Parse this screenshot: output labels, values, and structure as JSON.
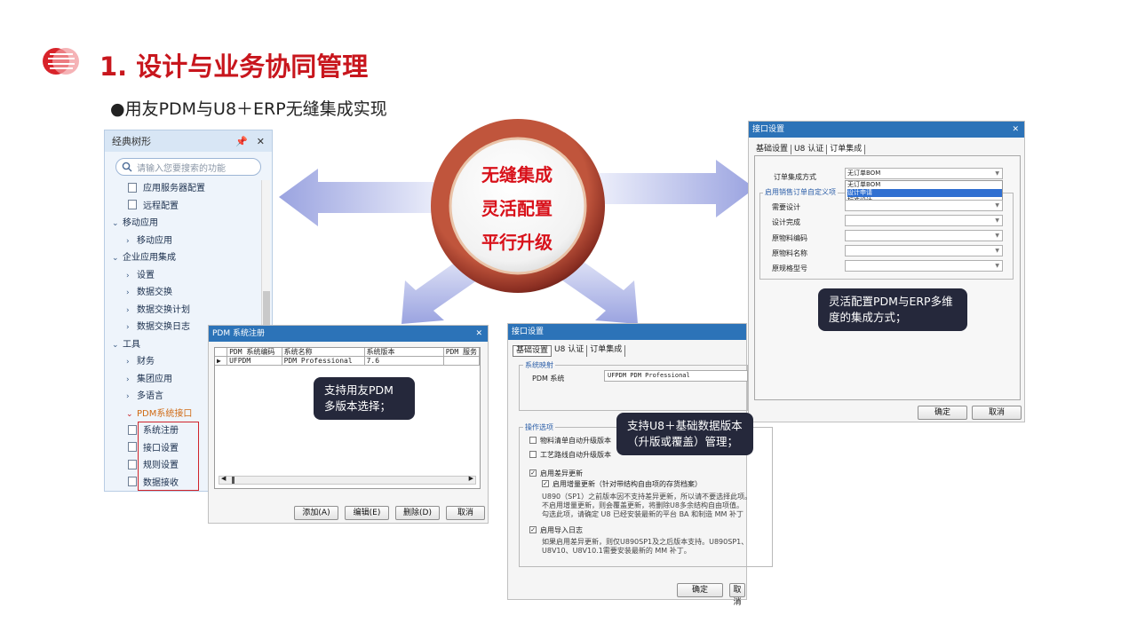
{
  "header": {
    "title": "1. 设计与业务协同管理",
    "subtitle": "●用友PDM与U8＋ERP无缝集成实现"
  },
  "center": {
    "lines": [
      "无缝集成",
      "灵活配置",
      "平行升级"
    ]
  },
  "tree": {
    "title": "经典树形",
    "search_placeholder": "请输入您要搜索的功能",
    "items": [
      {
        "label": "应用服务器配置",
        "level": 2,
        "kind": "doc"
      },
      {
        "label": "远程配置",
        "level": 2,
        "kind": "doc"
      },
      {
        "label": "移动应用",
        "level": 0,
        "kind": "open"
      },
      {
        "label": "移动应用",
        "level": 1,
        "kind": "closed"
      },
      {
        "label": "企业应用集成",
        "level": 0,
        "kind": "open"
      },
      {
        "label": "设置",
        "level": 1,
        "kind": "closed"
      },
      {
        "label": "数据交换",
        "level": 1,
        "kind": "closed"
      },
      {
        "label": "数据交换计划",
        "level": 1,
        "kind": "closed"
      },
      {
        "label": "数据交换日志",
        "level": 1,
        "kind": "closed"
      },
      {
        "label": "工具",
        "level": 0,
        "kind": "open"
      },
      {
        "label": "财务",
        "level": 1,
        "kind": "closed"
      },
      {
        "label": "集团应用",
        "level": 1,
        "kind": "closed"
      },
      {
        "label": "多语言",
        "level": 1,
        "kind": "closed"
      },
      {
        "label": "PDM系统接口",
        "level": 1,
        "kind": "openred"
      },
      {
        "label": "系统注册",
        "level": 2,
        "kind": "doc"
      },
      {
        "label": "接口设置",
        "level": 2,
        "kind": "doc"
      },
      {
        "label": "规则设置",
        "level": 2,
        "kind": "doc"
      },
      {
        "label": "数据接收",
        "level": 2,
        "kind": "doc"
      }
    ]
  },
  "pdm_dialog": {
    "title": "PDM 系统注册",
    "columns": [
      "PDM 系统编码",
      "系统名称",
      "系统版本",
      "PDM 服务"
    ],
    "row": [
      "UFPDM",
      "PDM Professional",
      "7.6",
      ""
    ],
    "buttons": {
      "add": "添加(A)",
      "edit": "编辑(E)",
      "delete": "删除(D)",
      "cancel": "取消"
    }
  },
  "iface_dialog": {
    "title": "接口设置",
    "tabs": [
      "基础设置",
      "U8 认证",
      "订单集成"
    ],
    "group_mapping": "系统映射",
    "pdm_system_label": "PDM 系统",
    "pdm_system_value": "UFPDM PDM Professional",
    "group_options": "操作选项",
    "opt1": "物料清单自动升级版本",
    "opt2": "工艺路线自动升级版本",
    "opt3": "启用差异更新",
    "opt3a": "启用增量更新（针对带结构自由项的存货档案）",
    "note1": "U890（SP1）之前版本因不支持差异更新，所以请不要选择此项。",
    "note2": "不启用增量更新，则会覆盖更新，将删除U8多余结构自由项值。",
    "note3": "勾选此项，请确定 U8 已经安装最新的平台 BA 和制造 MM 补丁",
    "opt4": "启用导入日志",
    "note4": "如果启用差异更新，则仅U890SP1及之后版本支持。U890SP1、",
    "note5": "U8V10、U8V10.1需要安装最新的 MM 补丁。",
    "ok": "确定",
    "cancel": "取消"
  },
  "iface_dialog2": {
    "title": "接口设置",
    "tabs": [
      "基础设置",
      "U8 认证",
      "订单集成"
    ],
    "order_mode_label": "订单集成方式",
    "order_mode_value": "无订单BOM",
    "dropdown_options": [
      "无订单BOM",
      "设计申请",
      "标准设计"
    ],
    "group_label": "启用销售订单自定义项",
    "fields": [
      "需要设计",
      "设计完成",
      "原物料编码",
      "原物料名称",
      "原规格型号"
    ],
    "ok": "确定",
    "cancel": "取消"
  },
  "callouts": {
    "pdm": "支持用友PDM多版本选择；",
    "upgrade": "支持U8＋基础数据版本（升版或覆盖）管理；",
    "config": "灵活配置PDM与ERP多维度的集成方式；"
  },
  "colors": {
    "title_red": "#c8161d",
    "center_text": "#d8111a",
    "dialog_titlebar": "#2c73b8",
    "callout_bg": "#25283b",
    "arrow": "#aab0e6"
  }
}
